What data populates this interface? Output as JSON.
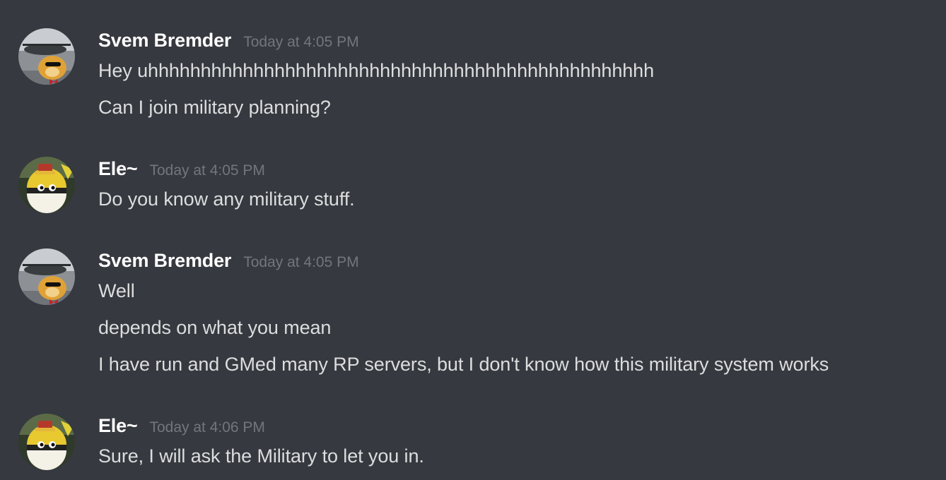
{
  "messages": [
    {
      "author": "Svem Bremder",
      "timestamp": "Today at 4:05 PM",
      "avatar": "svem-avatar",
      "lines": [
        "Hey uhhhhhhhhhhhhhhhhhhhhhhhhhhhhhhhhhhhhhhhhhhhhhhhh",
        "Can I join military planning?"
      ]
    },
    {
      "author": "Ele~",
      "timestamp": "Today at 4:05 PM",
      "avatar": "ele-avatar",
      "lines": [
        "Do you know any military stuff."
      ]
    },
    {
      "author": "Svem Bremder",
      "timestamp": "Today at 4:05 PM",
      "avatar": "svem-avatar",
      "lines": [
        "Well",
        "depends on what you mean",
        "I have run and GMed many RP servers, but I don't know how this military system works"
      ]
    },
    {
      "author": "Ele~",
      "timestamp": "Today at 4:06 PM",
      "avatar": "ele-avatar",
      "lines": [
        "Sure, I will ask the Military to let you in."
      ]
    }
  ],
  "colors": {
    "background": "#36393f",
    "username": "#ffffff",
    "timestamp": "#72767d",
    "message_text": "#dcddde"
  }
}
